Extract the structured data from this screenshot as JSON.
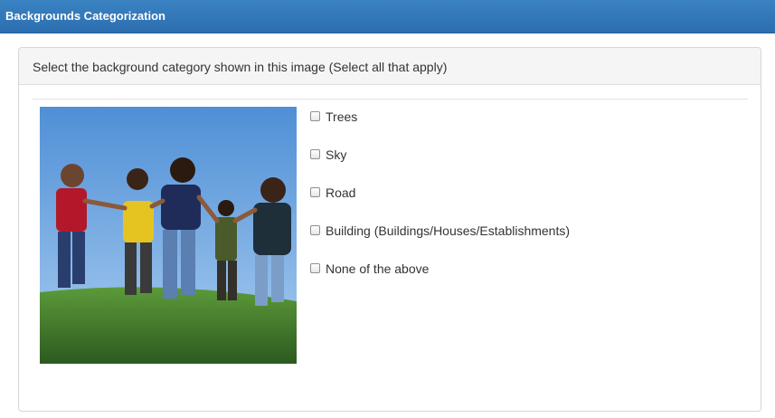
{
  "header": {
    "title": "Backgrounds Categorization"
  },
  "panel": {
    "question": "Select the background category shown in this image (Select all that apply)"
  },
  "image": {
    "description_icon": "photo-children-playing-icon"
  },
  "options": [
    {
      "label": "Trees",
      "checked": false
    },
    {
      "label": "Sky",
      "checked": false
    },
    {
      "label": "Road",
      "checked": false
    },
    {
      "label": "Building (Buildings/Houses/Establishments)",
      "checked": false
    },
    {
      "label": "None of the above",
      "checked": false
    }
  ],
  "colors": {
    "header_bg": "#2c6eaf",
    "panel_heading_bg": "#f5f5f5",
    "sky": "#6aa3dc",
    "grass": "#3f7a2c"
  }
}
